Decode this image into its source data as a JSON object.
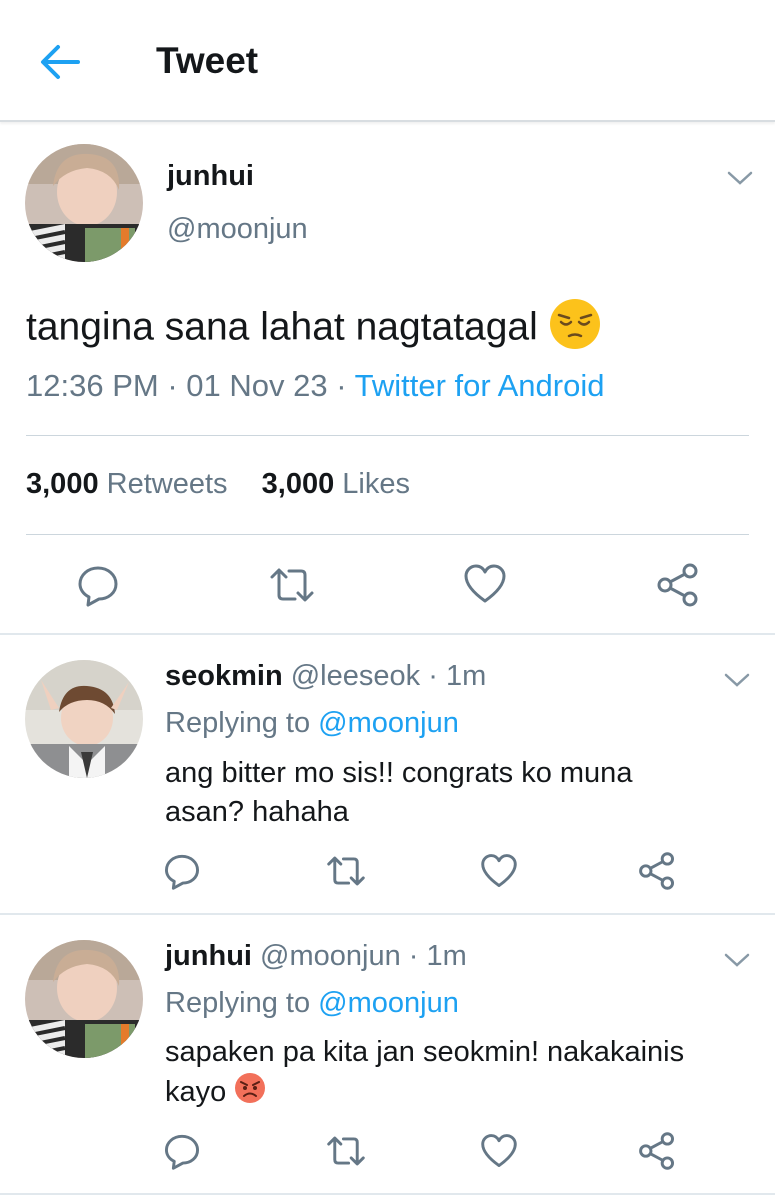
{
  "header": {
    "title": "Tweet"
  },
  "main_tweet": {
    "name": "junhui",
    "handle": "@moonjun",
    "text": "tangina sana lahat nagtatagal",
    "time": "12:36 PM",
    "date": "01 Nov 23",
    "source": "Twitter for Android",
    "retweets_count": "3,000",
    "retweets_label": "Retweets",
    "likes_count": "3,000",
    "likes_label": "Likes",
    "emoji": "pensive-face"
  },
  "replies": [
    {
      "name": "seokmin",
      "handle": "@leeseok",
      "time": "1m",
      "replying_label": "Replying to",
      "replying_to": "@moonjun",
      "text_line1": "ang bitter mo sis!! congrats ko muna",
      "text_line2": "asan? hahaha"
    },
    {
      "name": "junhui",
      "handle": "@moonjun",
      "time": "1m",
      "replying_label": "Replying to",
      "replying_to": "@moonjun",
      "text_line1": "sapaken pa kita jan seokmin! nakakainis",
      "text_line2": "kayo",
      "emoji": "angry-face"
    }
  ],
  "separator": "·",
  "colors": {
    "accent": "#1da1f2",
    "muted": "#657786",
    "text": "#14171a",
    "icon": "#657786"
  }
}
